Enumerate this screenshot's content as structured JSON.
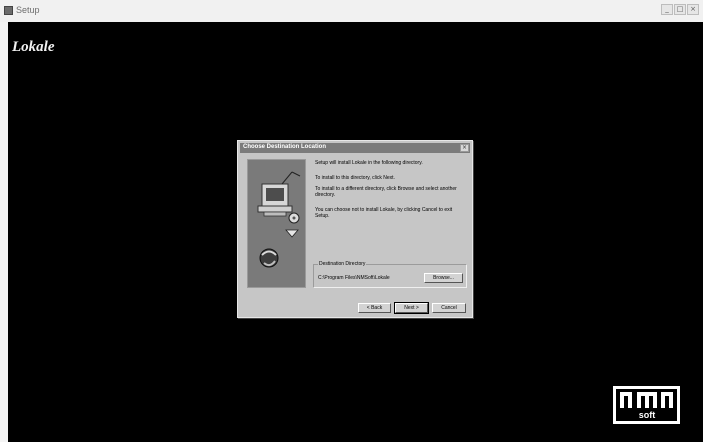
{
  "window": {
    "title": "Setup"
  },
  "backdrop": {
    "app_name": "Lokale",
    "logo_text": "soft"
  },
  "dialog": {
    "title": "Choose Destination Location",
    "messages": [
      "Setup will install Lokale in the following directory.",
      "To install to this directory, click Next.",
      "To install to a different directory, click Browse and select another directory.",
      "You can choose not to install Lokale, by clicking Cancel to exit Setup."
    ],
    "destination": {
      "label": "Destination Directory",
      "path": "C:\\Program Files\\NMSoft\\Lokale"
    },
    "buttons": {
      "browse": "Browse...",
      "back": "< Back",
      "next": "Next >",
      "cancel": "Cancel"
    }
  }
}
